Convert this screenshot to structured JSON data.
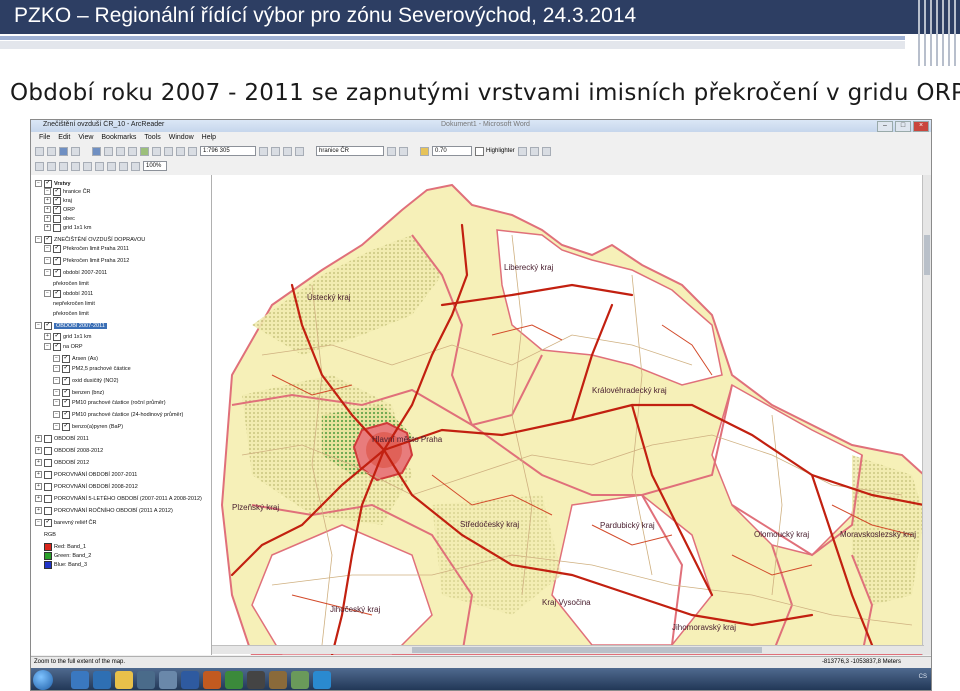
{
  "slide": {
    "title": "PZKO – Regionální řídící výbor pro zónu Severovýchod, 24.3.2014",
    "subtitle": "Období roku 2007 - 2011 se zapnutými vrstvami imisních překročení v gridu ORP"
  },
  "app": {
    "window_title": "Znečištění ovzduší ČR_10 - ArcReader",
    "background_window": "Dokument1 - Microsoft Word",
    "menu": [
      "File",
      "Edit",
      "View",
      "Bookmarks",
      "Tools",
      "Window",
      "Help"
    ],
    "scale": "1:796 305",
    "layer_combo": "hranice ČR",
    "opacity_combo": "0.70",
    "highlighter_label": "Highlighter",
    "zoom_combo": "100%",
    "status_left": "Zoom to the full extent of the map.",
    "status_right": "-813776,3  -1053837,8 Meters",
    "tray_text": "CS"
  },
  "toc": [
    {
      "label": "Vrstvy",
      "level": 0,
      "expander": "−",
      "checked": true,
      "bold": true
    },
    {
      "label": "hranice ČR",
      "level": 1,
      "expander": "−",
      "checked": true
    },
    {
      "label": "kraj",
      "level": 1,
      "expander": "+",
      "checked": true
    },
    {
      "label": "ORP",
      "level": 1,
      "expander": "+",
      "checked": true
    },
    {
      "label": "obec",
      "level": 1,
      "expander": "+",
      "checked": false
    },
    {
      "label": "grid 1x1 km",
      "level": 1,
      "expander": "+",
      "checked": false
    },
    {
      "label": "ZNEČIŠTĚNÍ OVZDUŠÍ DOPRAVOU",
      "level": 0,
      "expander": "−",
      "checked": true
    },
    {
      "label": "Překročen limit Praha 2011",
      "level": 1,
      "expander": "−",
      "checked": true
    },
    {
      "label": "Překročen limit Praha 2012",
      "level": 1,
      "expander": "−",
      "checked": true
    },
    {
      "label": "období 2007-2011",
      "level": 1,
      "expander": "−",
      "checked": true
    },
    {
      "label": "překročen limit",
      "level": 2,
      "expander": "",
      "checked": null
    },
    {
      "label": "období 2011",
      "level": 1,
      "expander": "−",
      "checked": true
    },
    {
      "label": "nepřekročen limit",
      "level": 2,
      "expander": "",
      "checked": null
    },
    {
      "label": "překročen limit",
      "level": 2,
      "expander": "",
      "checked": null
    },
    {
      "label": "OBDOBÍ 2007-2011",
      "level": 0,
      "expander": "−",
      "checked": true,
      "selected": true
    },
    {
      "label": "grid 1x1 km",
      "level": 1,
      "expander": "+",
      "checked": true
    },
    {
      "label": "na ORP",
      "level": 1,
      "expander": "−",
      "checked": true
    },
    {
      "label": "Arsen (As)",
      "level": 2,
      "expander": "−",
      "checked": true
    },
    {
      "label": "PM2,5 prachové částice",
      "level": 2,
      "expander": "−",
      "checked": true
    },
    {
      "label": "oxid dusičitý (NO2)",
      "level": 2,
      "expander": "−",
      "checked": true
    },
    {
      "label": "benzen (bnz)",
      "level": 2,
      "expander": "−",
      "checked": true
    },
    {
      "label": "PM10 prachové částice (roční průměr)",
      "level": 2,
      "expander": "−",
      "checked": true
    },
    {
      "label": "PM10 prachové částice (24-hodinový průměr)",
      "level": 2,
      "expander": "−",
      "checked": true
    },
    {
      "label": "benzo(a)pyren (BaP)",
      "level": 2,
      "expander": "−",
      "checked": true
    },
    {
      "label": "OBDOBÍ 2011",
      "level": 0,
      "expander": "+",
      "checked": false
    },
    {
      "label": "OBDOBÍ 2008-2012",
      "level": 0,
      "expander": "+",
      "checked": false
    },
    {
      "label": "OBDOBÍ 2012",
      "level": 0,
      "expander": "+",
      "checked": false
    },
    {
      "label": "POROVNÁNÍ OBDOBÍ 2007-2011",
      "level": 0,
      "expander": "+",
      "checked": false
    },
    {
      "label": "POROVNÁNÍ OBDOBÍ 2008-2012",
      "level": 0,
      "expander": "+",
      "checked": false
    },
    {
      "label": "POROVNÁNÍ 5-LETÉHO OBDOBÍ (2007-2011 A 2008-2012)",
      "level": 0,
      "expander": "+",
      "checked": false
    },
    {
      "label": "POROVNÁNÍ ROČNÍHO OBDOBÍ (2011 A 2012)",
      "level": 0,
      "expander": "+",
      "checked": false
    },
    {
      "label": "barevný reliéf ČR",
      "level": 0,
      "expander": "−",
      "checked": true
    },
    {
      "label": "RGB",
      "level": 1,
      "expander": "",
      "checked": null
    },
    {
      "label": "Red:  Band_1",
      "level": 1,
      "expander": "",
      "checked": null,
      "swatch": "#d9261c"
    },
    {
      "label": "Green: Band_2",
      "level": 1,
      "expander": "",
      "checked": null,
      "swatch": "#2aa02a"
    },
    {
      "label": "Blue:  Band_3",
      "level": 1,
      "expander": "",
      "checked": null,
      "swatch": "#2034c8"
    }
  ],
  "map": {
    "labels": [
      "Liberecký kraj",
      "Ústecký kraj",
      "Hlavní město Praha",
      "Královéhradecký kraj",
      "Plzeňský kraj",
      "Středočeský kraj",
      "Pardubický kraj",
      "Olomoucký kraj",
      "Moravskoslezský kraj",
      "Jihočeský kraj",
      "Kraj Vysočina",
      "Jihomoravský kraj"
    ],
    "colors": {
      "yellow": "#f6f0b8",
      "hatch": "#d9d88d",
      "border": "#e0707a",
      "road": "#c22010",
      "road_minor": "#cfb080"
    }
  }
}
